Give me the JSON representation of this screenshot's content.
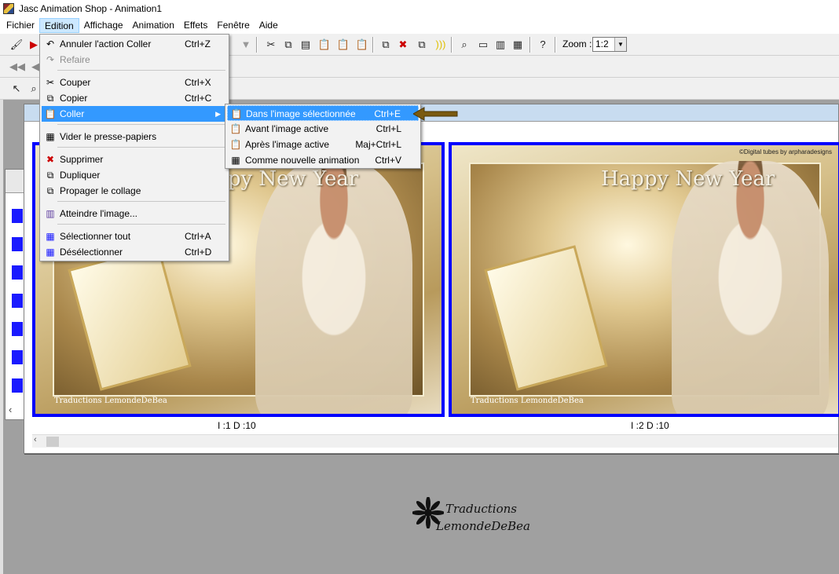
{
  "window": {
    "title": "Jasc Animation Shop - Animation1"
  },
  "menubar": [
    "Fichier",
    "Edition",
    "Affichage",
    "Animation",
    "Effets",
    "Fenêtre",
    "Aide"
  ],
  "toolbar": {
    "zoom_label": "Zoom :",
    "zoom_value": "1:2"
  },
  "edit_menu": {
    "items": [
      {
        "label": "Annuler l'action Coller",
        "shortcut": "Ctrl+Z",
        "icon": "undo-icon",
        "state": "normal"
      },
      {
        "label": "Refaire",
        "shortcut": "",
        "icon": "redo-icon",
        "state": "disabled"
      },
      {
        "label": "Couper",
        "shortcut": "Ctrl+X",
        "icon": "scissors-icon",
        "state": "normal"
      },
      {
        "label": "Copier",
        "shortcut": "Ctrl+C",
        "icon": "copy-icon",
        "state": "normal"
      },
      {
        "label": "Coller",
        "shortcut": "",
        "icon": "paste-icon",
        "state": "highlighted",
        "has_submenu": true
      },
      {
        "label": "Vider le presse-papiers",
        "shortcut": "",
        "icon": "clipboard-clear-icon",
        "state": "normal"
      },
      {
        "label": "Supprimer",
        "shortcut": "",
        "icon": "delete-icon",
        "state": "normal"
      },
      {
        "label": "Dupliquer",
        "shortcut": "",
        "icon": "duplicate-icon",
        "state": "normal"
      },
      {
        "label": "Propager le collage",
        "shortcut": "",
        "icon": "propagate-icon",
        "state": "normal"
      },
      {
        "label": "Atteindre l'image...",
        "shortcut": "",
        "icon": "goto-frame-icon",
        "state": "normal"
      },
      {
        "label": "Sélectionner tout",
        "shortcut": "Ctrl+A",
        "icon": "select-all-icon",
        "state": "normal"
      },
      {
        "label": "Désélectionner",
        "shortcut": "Ctrl+D",
        "icon": "deselect-icon",
        "state": "normal"
      }
    ]
  },
  "paste_submenu": {
    "items": [
      {
        "label": "Dans l'image sélectionnée",
        "shortcut": "Ctrl+E",
        "state": "highlighted"
      },
      {
        "label": "Avant l'image active",
        "shortcut": "Ctrl+L",
        "state": "normal"
      },
      {
        "label": "Après l'image active",
        "shortcut": "Maj+Ctrl+L",
        "state": "normal"
      },
      {
        "label": "Comme nouvelle animation",
        "shortcut": "Ctrl+V",
        "state": "normal"
      }
    ]
  },
  "frames": [
    {
      "label": "I :1   D :10",
      "art_text": "Happy New Year",
      "signature": "Traductions LemondeDeBea"
    },
    {
      "label": "I :2   D :10",
      "art_text": "Happy New Year",
      "signature": "Traductions LemondeDeBea",
      "credit": "©Digital tubes by arpharadesigns"
    }
  ],
  "watermark": {
    "line1": "Traductions",
    "line2": "LemondeDeBea"
  },
  "colors": {
    "selection_blue": "#3399ff",
    "frame_border": "#0000ff",
    "workspace": "#a0a0a0"
  }
}
